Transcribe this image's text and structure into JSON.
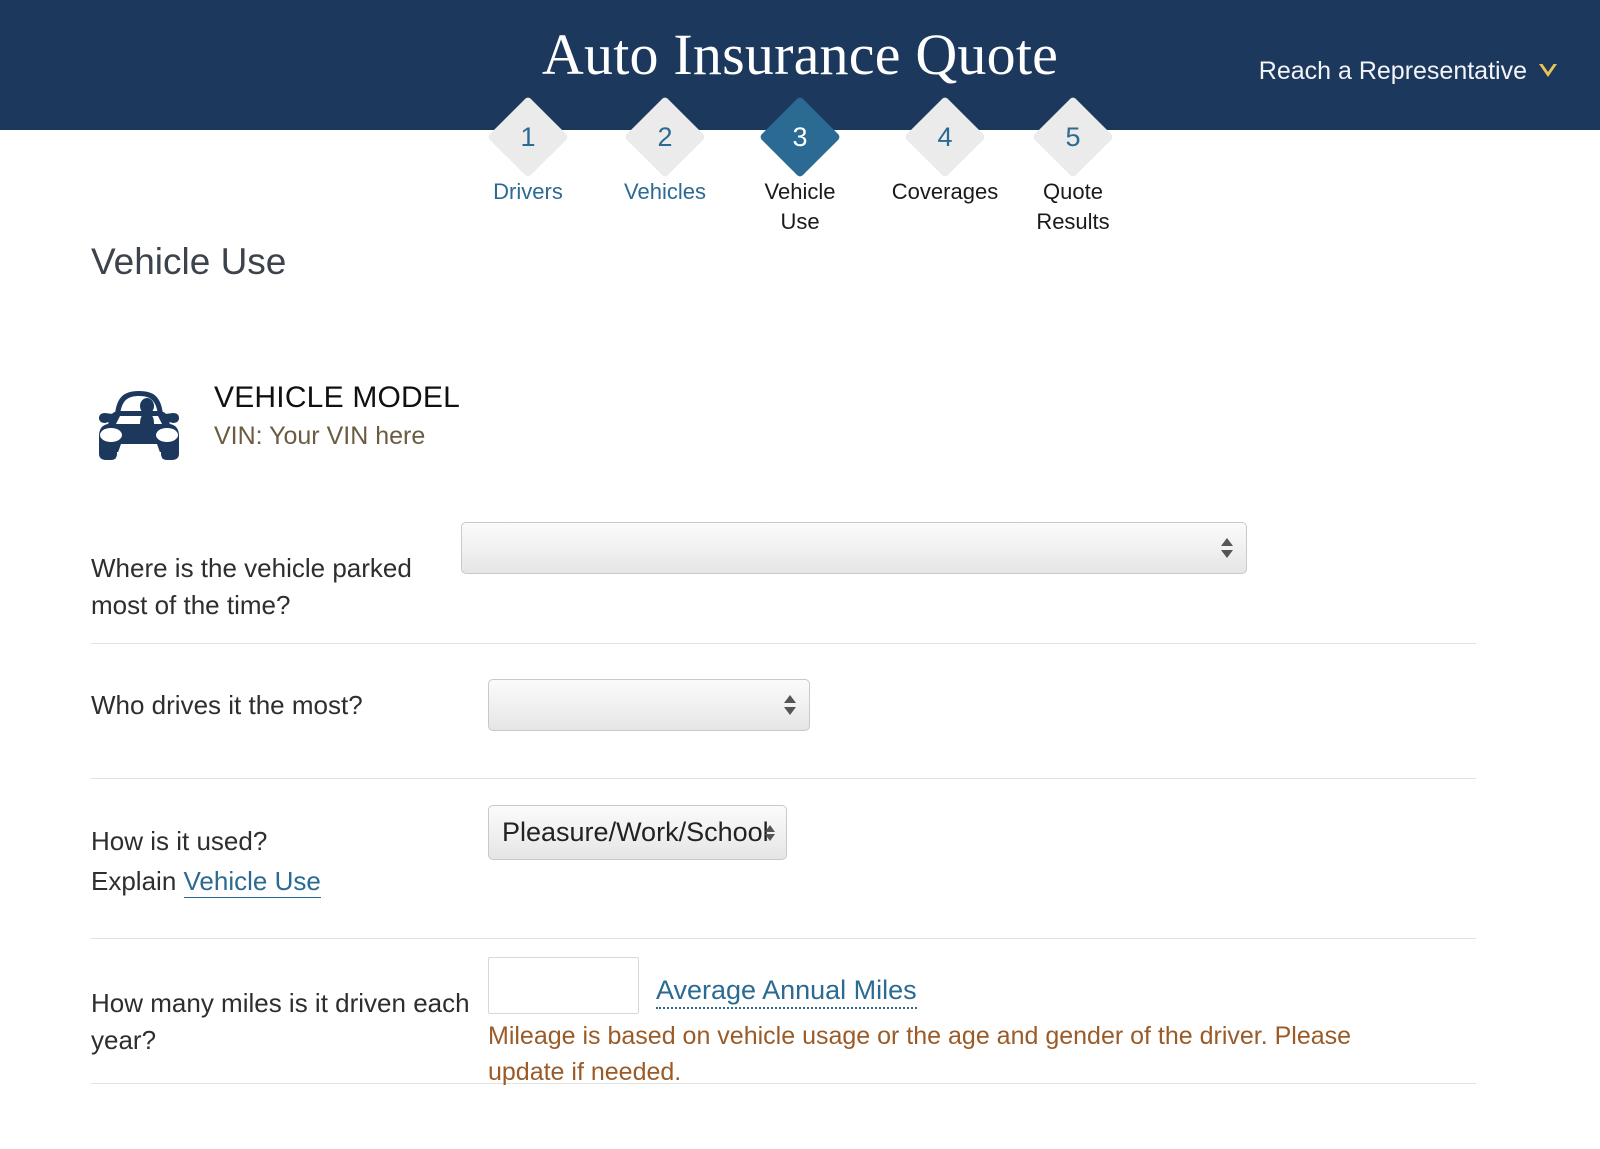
{
  "header": {
    "title": "Auto Insurance Quote",
    "rep_label": "Reach a Representative",
    "chevron_icon": "chevron-down-icon",
    "chevron_color": "#e8c452",
    "bg_color": "#1c395d"
  },
  "stepper": {
    "active_index": 2,
    "steps": [
      {
        "number": "1",
        "label": "Drivers",
        "state": "complete"
      },
      {
        "number": "2",
        "label": "Vehicles",
        "state": "complete"
      },
      {
        "number": "3",
        "label": "Vehicle Use",
        "state": "current"
      },
      {
        "number": "4",
        "label": "Coverages",
        "state": "future"
      },
      {
        "number": "5",
        "label": "Quote Results",
        "state": "future"
      }
    ],
    "active_color": "#2b6a93",
    "inactive_color": "#ecebeb"
  },
  "page": {
    "title": "Vehicle Use"
  },
  "vehicle": {
    "icon": "car-front-icon",
    "model": "VEHICLE MODEL",
    "vin": "VIN: Your VIN here",
    "vin_color": "#6b5b42"
  },
  "form": {
    "rows": [
      {
        "label": "Where is the vehicle parked most of the time?",
        "control": "select",
        "value": "",
        "options": []
      },
      {
        "label": "Who drives it the most?",
        "control": "select",
        "value": "",
        "options": []
      },
      {
        "label_line1": "How is it used?",
        "label_line2_prefix": "Explain ",
        "label_line2_link": "Vehicle Use",
        "control": "select",
        "value": "Pleasure/Work/School",
        "options": [
          "Pleasure/Work/School"
        ]
      },
      {
        "label": "How many miles is it driven each year?",
        "control": "text",
        "value": "",
        "link_label": "Average Annual Miles",
        "note": "Mileage is based on vehicle usage or the age and gender of the driver. Please update if needed.",
        "note_color": "#9a5b28"
      }
    ]
  },
  "colors": {
    "link": "#2b6a93",
    "page_title": "#3c434c",
    "divider": "#e2e2e2"
  }
}
